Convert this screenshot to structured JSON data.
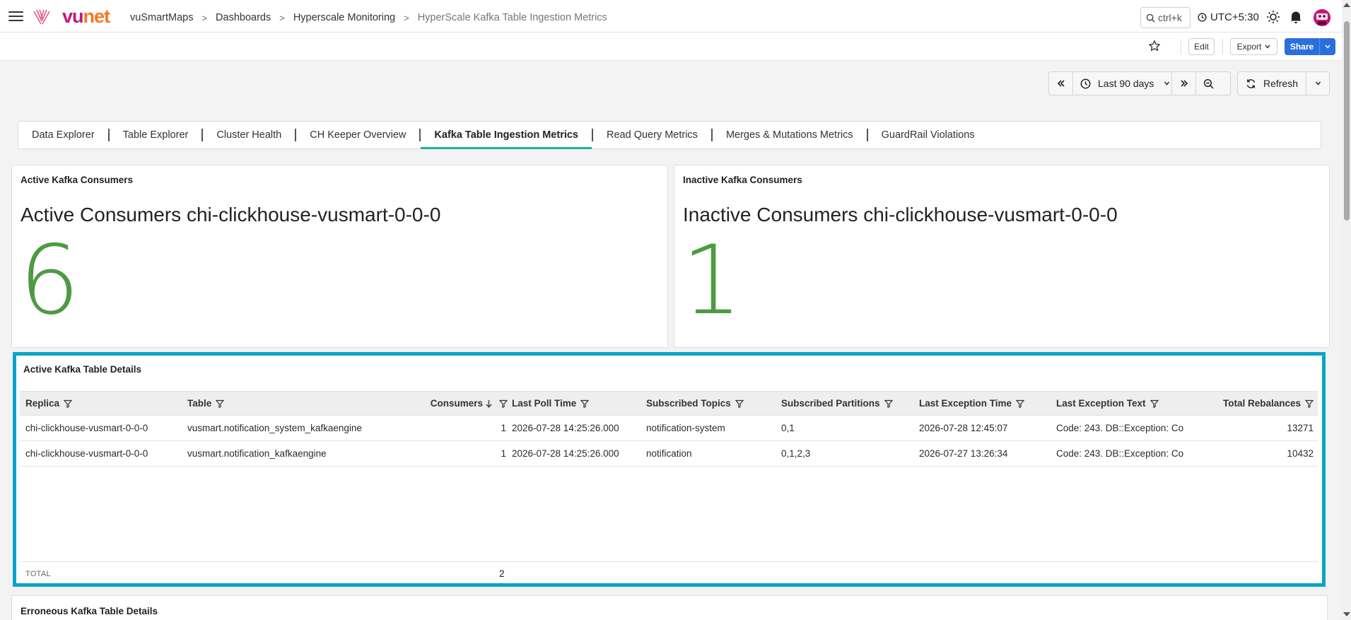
{
  "brand": {
    "logo_vu": "vu",
    "logo_net": "net",
    "color_primary": "#c2187a",
    "color_secondary": "#f07b22"
  },
  "breadcrumb": [
    "vuSmartMaps",
    "Dashboards",
    "Hyperscale Monitoring",
    "HyperScale Kafka Table Ingestion Metrics"
  ],
  "header": {
    "search_hint": "ctrl+k",
    "timezone": "UTC+5:30"
  },
  "actions": {
    "edit": "Edit",
    "export": "Export",
    "share": "Share"
  },
  "time": {
    "range": "Last 90 days",
    "refresh": "Refresh"
  },
  "tabs": [
    "Data Explorer",
    "Table Explorer",
    "Cluster Health",
    "CH Keeper Overview",
    "Kafka Table Ingestion Metrics",
    "Read Query Metrics",
    "Merges & Mutations Metrics",
    "GuardRail Violations"
  ],
  "active_tab_index": 4,
  "active_panel": {
    "title": "Active Kafka Consumers",
    "label": "Active Consumers chi-clickhouse-vusmart-0-0-0",
    "value": "6"
  },
  "inactive_panel": {
    "title": "Inactive Kafka Consumers",
    "label": "Inactive Consumers chi-clickhouse-vusmart-0-0-0",
    "value": "1"
  },
  "stat_color": "#4e9a43",
  "table_panel": {
    "title": "Active Kafka Table Details",
    "columns": [
      "Replica",
      "Table",
      "Consumers",
      "Last Poll Time",
      "Subscribed Topics",
      "Subscribed Partitions",
      "Last Exception Time",
      "Last Exception Text",
      "Total Rebalances"
    ],
    "rows": [
      [
        "chi-clickhouse-vusmart-0-0-0",
        "vusmart.notification_system_kafkaengine",
        "1",
        "2026-07-28 14:25:26.000",
        "notification-system",
        "0,1",
        "2026-07-28 12:45:07",
        "Code: 243. DB::Exception: Co",
        "13271"
      ],
      [
        "chi-clickhouse-vusmart-0-0-0",
        "vusmart.notification_kafkaengine",
        "1",
        "2026-07-28 14:25:26.000",
        "notification",
        "0,1,2,3",
        "2026-07-27 13:26:34",
        "Code: 243. DB::Exception: Co",
        "10432"
      ]
    ],
    "total_label": "TOTAL",
    "total_value": "2",
    "highlight_color": "#0aa5c8"
  },
  "bottom_panel": {
    "title": "Erroneous Kafka Table Details"
  }
}
